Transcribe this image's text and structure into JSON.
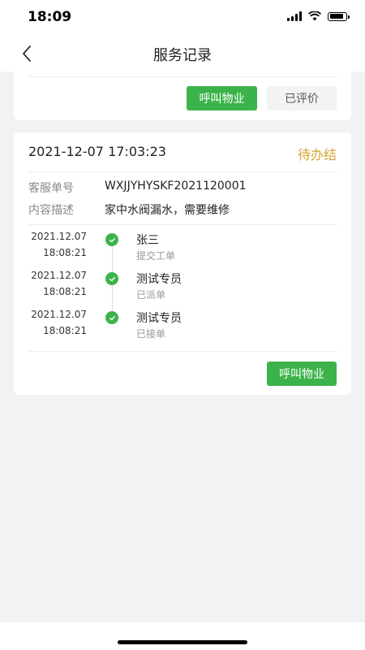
{
  "status_bar": {
    "time": "18:09"
  },
  "nav": {
    "title": "服务记录"
  },
  "card1": {
    "call_button": "呼叫物业",
    "rated_button": "已评价"
  },
  "card2": {
    "datetime": "2021-12-07 17:03:23",
    "status": "待办结",
    "fields": [
      {
        "label": "客服单号",
        "value": "WXJJYHYSKF2021120001"
      },
      {
        "label": "内容描述",
        "value": "家中水阀漏水，需要维修"
      }
    ],
    "timeline": [
      {
        "date": "2021.12.07",
        "time": "18:08:21",
        "name": "张三",
        "action": "提交工单"
      },
      {
        "date": "2021.12.07",
        "time": "18:08:21",
        "name": "测试专员",
        "action": "已派单"
      },
      {
        "date": "2021.12.07",
        "time": "18:08:21",
        "name": "测试专员",
        "action": "已接单"
      }
    ],
    "call_button": "呼叫物业"
  },
  "colors": {
    "accent_green": "#3cb34a",
    "status_pending": "#d4a531"
  }
}
